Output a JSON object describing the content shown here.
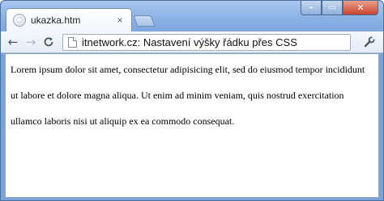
{
  "browser": {
    "tab": {
      "title": "ukazka.htm",
      "close_glyph": "×"
    },
    "window_controls": {
      "minimize": "–",
      "maximize": "▭",
      "close": "✕"
    },
    "nav": {
      "back": "←",
      "forward": "→",
      "reload": "C"
    },
    "address": {
      "url": "itnetwork.cz: Nastavení výšky řádku přes CSS"
    },
    "menu_glyph": "🔧"
  },
  "page": {
    "paragraph": "Lorem ipsum dolor sit amet, consectetur adipisicing elit, sed do eiusmod tempor incididunt ut labore et dolore magna aliqua. Ut enim ad minim veniam, quis nostrud exercitation ullamco laboris nisi ut aliquip ex ea commodo consequat."
  },
  "colors": {
    "frame": "#7ea7de",
    "close_button": "#c9452c"
  }
}
